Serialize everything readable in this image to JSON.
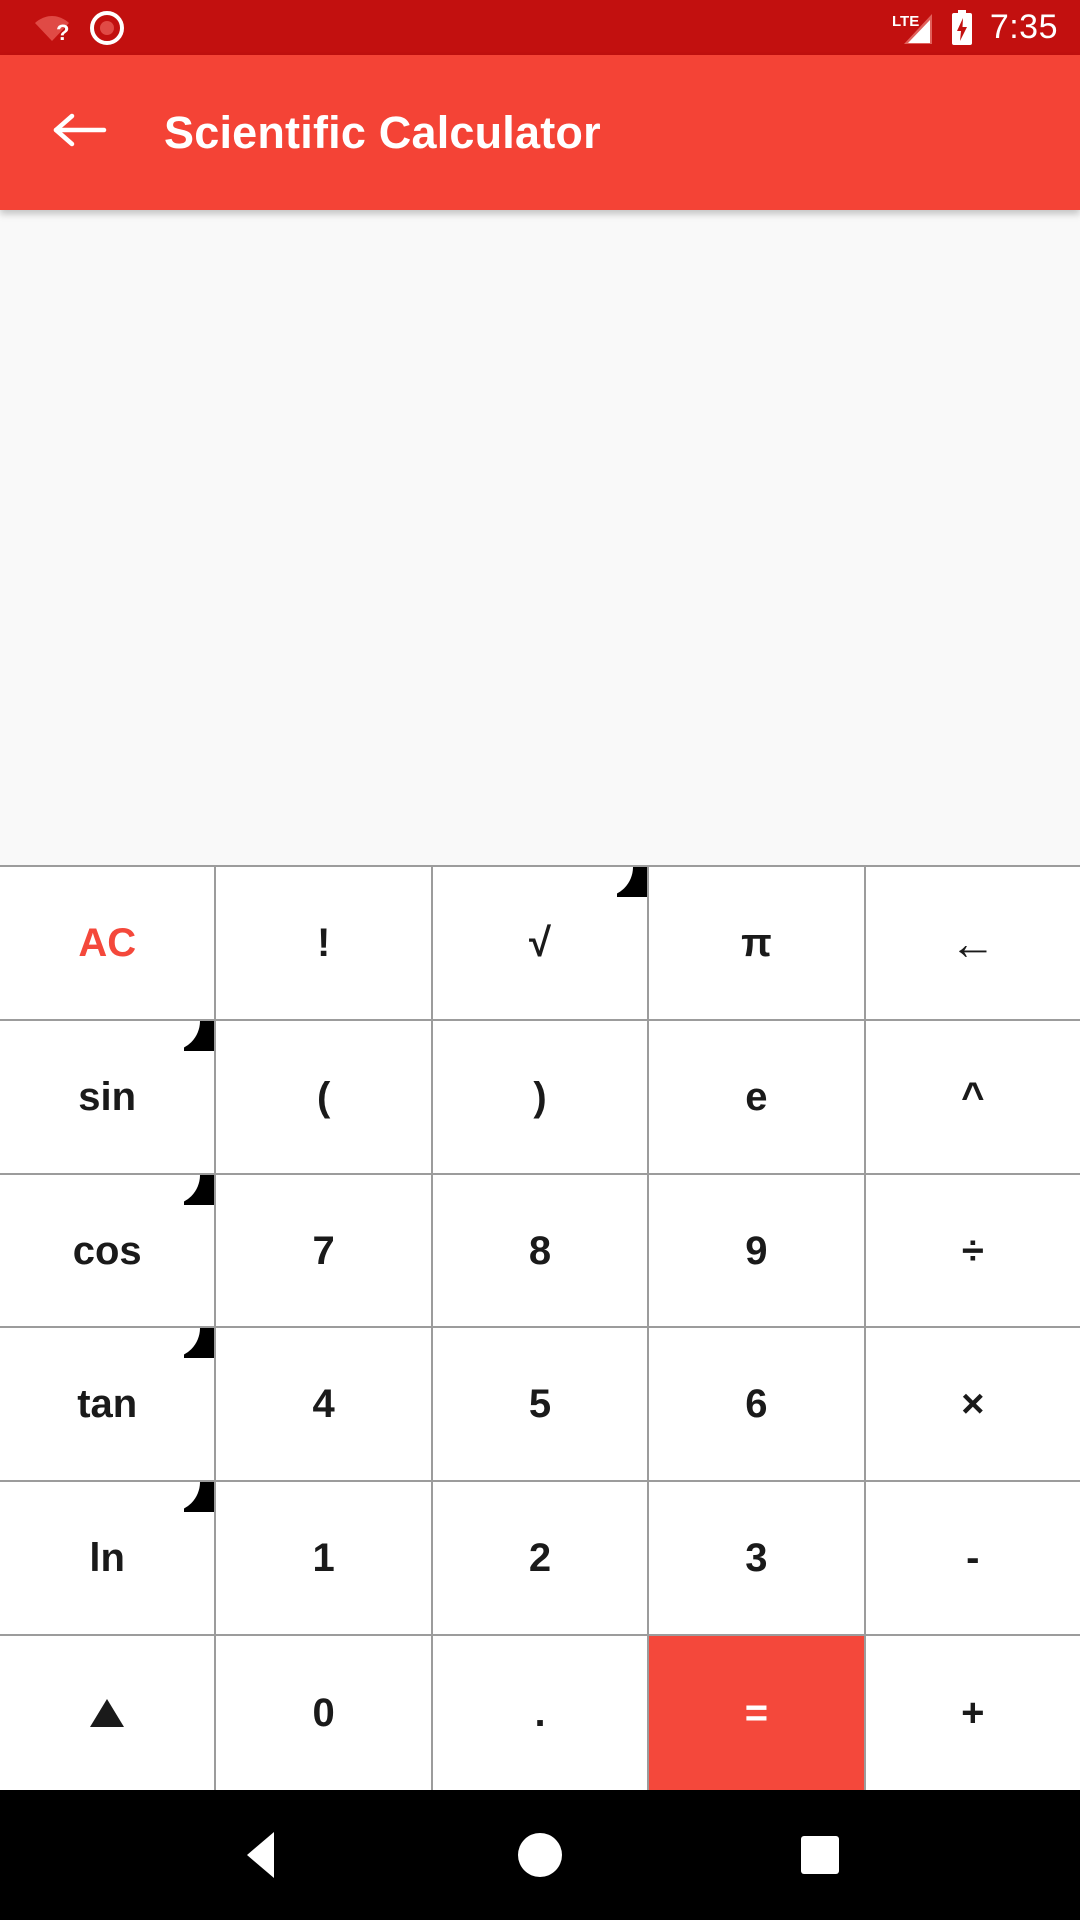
{
  "status_bar": {
    "background_color": "#c2100f",
    "time": "7:35",
    "icons": [
      {
        "name": "wifi-no-connection-icon",
        "label": "wifi-question"
      },
      {
        "name": "screen-record-icon",
        "label": "recording"
      },
      {
        "name": "lte-signal-icon",
        "label": "LTE"
      },
      {
        "name": "battery-charging-icon",
        "label": "battery"
      }
    ],
    "network_label": "LTE"
  },
  "app_bar": {
    "background_color": "#f44336",
    "title": "Scientific Calculator",
    "back_icon": "arrow-left-icon"
  },
  "display": {
    "background_color": "#f9f9f9",
    "expression": "",
    "result": ""
  },
  "keypad": {
    "accent_color": "#f4483b",
    "key_background": "#ffffff",
    "grid_line_color": "#9c9c9c",
    "rows": [
      [
        {
          "label": "AC",
          "name": "key-all-clear",
          "style": "ac",
          "corner": false
        },
        {
          "label": "!",
          "name": "key-factorial",
          "style": "normal",
          "corner": false
        },
        {
          "label": "√",
          "name": "key-square-root",
          "style": "normal",
          "corner": true
        },
        {
          "label": "π",
          "name": "key-pi",
          "style": "normal",
          "corner": false
        },
        {
          "label": "←",
          "name": "key-backspace",
          "style": "big",
          "corner": false
        }
      ],
      [
        {
          "label": "sin",
          "name": "key-sin",
          "style": "normal",
          "corner": true
        },
        {
          "label": "(",
          "name": "key-open-paren",
          "style": "normal",
          "corner": false
        },
        {
          "label": ")",
          "name": "key-close-paren",
          "style": "normal",
          "corner": false
        },
        {
          "label": "e",
          "name": "key-euler",
          "style": "normal",
          "corner": false
        },
        {
          "label": "^",
          "name": "key-power",
          "style": "normal",
          "corner": false
        }
      ],
      [
        {
          "label": "cos",
          "name": "key-cos",
          "style": "normal",
          "corner": true
        },
        {
          "label": "7",
          "name": "key-7",
          "style": "normal",
          "corner": false
        },
        {
          "label": "8",
          "name": "key-8",
          "style": "normal",
          "corner": false
        },
        {
          "label": "9",
          "name": "key-9",
          "style": "normal",
          "corner": false
        },
        {
          "label": "÷",
          "name": "key-divide",
          "style": "normal",
          "corner": false
        }
      ],
      [
        {
          "label": "tan",
          "name": "key-tan",
          "style": "normal",
          "corner": true
        },
        {
          "label": "4",
          "name": "key-4",
          "style": "normal",
          "corner": false
        },
        {
          "label": "5",
          "name": "key-5",
          "style": "normal",
          "corner": false
        },
        {
          "label": "6",
          "name": "key-6",
          "style": "normal",
          "corner": false
        },
        {
          "label": "×",
          "name": "key-multiply",
          "style": "normal",
          "corner": false
        }
      ],
      [
        {
          "label": "ln",
          "name": "key-natural-log",
          "style": "normal",
          "corner": true
        },
        {
          "label": "1",
          "name": "key-1",
          "style": "normal",
          "corner": false
        },
        {
          "label": "2",
          "name": "key-2",
          "style": "normal",
          "corner": false
        },
        {
          "label": "3",
          "name": "key-3",
          "style": "normal",
          "corner": false
        },
        {
          "label": "-",
          "name": "key-subtract",
          "style": "normal",
          "corner": false
        }
      ],
      [
        {
          "label": "▲",
          "name": "key-expand-up",
          "style": "triangle",
          "corner": false
        },
        {
          "label": "0",
          "name": "key-0",
          "style": "normal",
          "corner": false
        },
        {
          "label": ".",
          "name": "key-decimal",
          "style": "normal",
          "corner": false
        },
        {
          "label": "=",
          "name": "key-equals",
          "style": "eq",
          "corner": false
        },
        {
          "label": "+",
          "name": "key-add",
          "style": "normal",
          "corner": false
        }
      ]
    ]
  },
  "nav_bar": {
    "background_color": "#000000",
    "buttons": [
      {
        "name": "nav-back-button",
        "label": "Back"
      },
      {
        "name": "nav-home-button",
        "label": "Home"
      },
      {
        "name": "nav-recents-button",
        "label": "Recents"
      }
    ]
  }
}
